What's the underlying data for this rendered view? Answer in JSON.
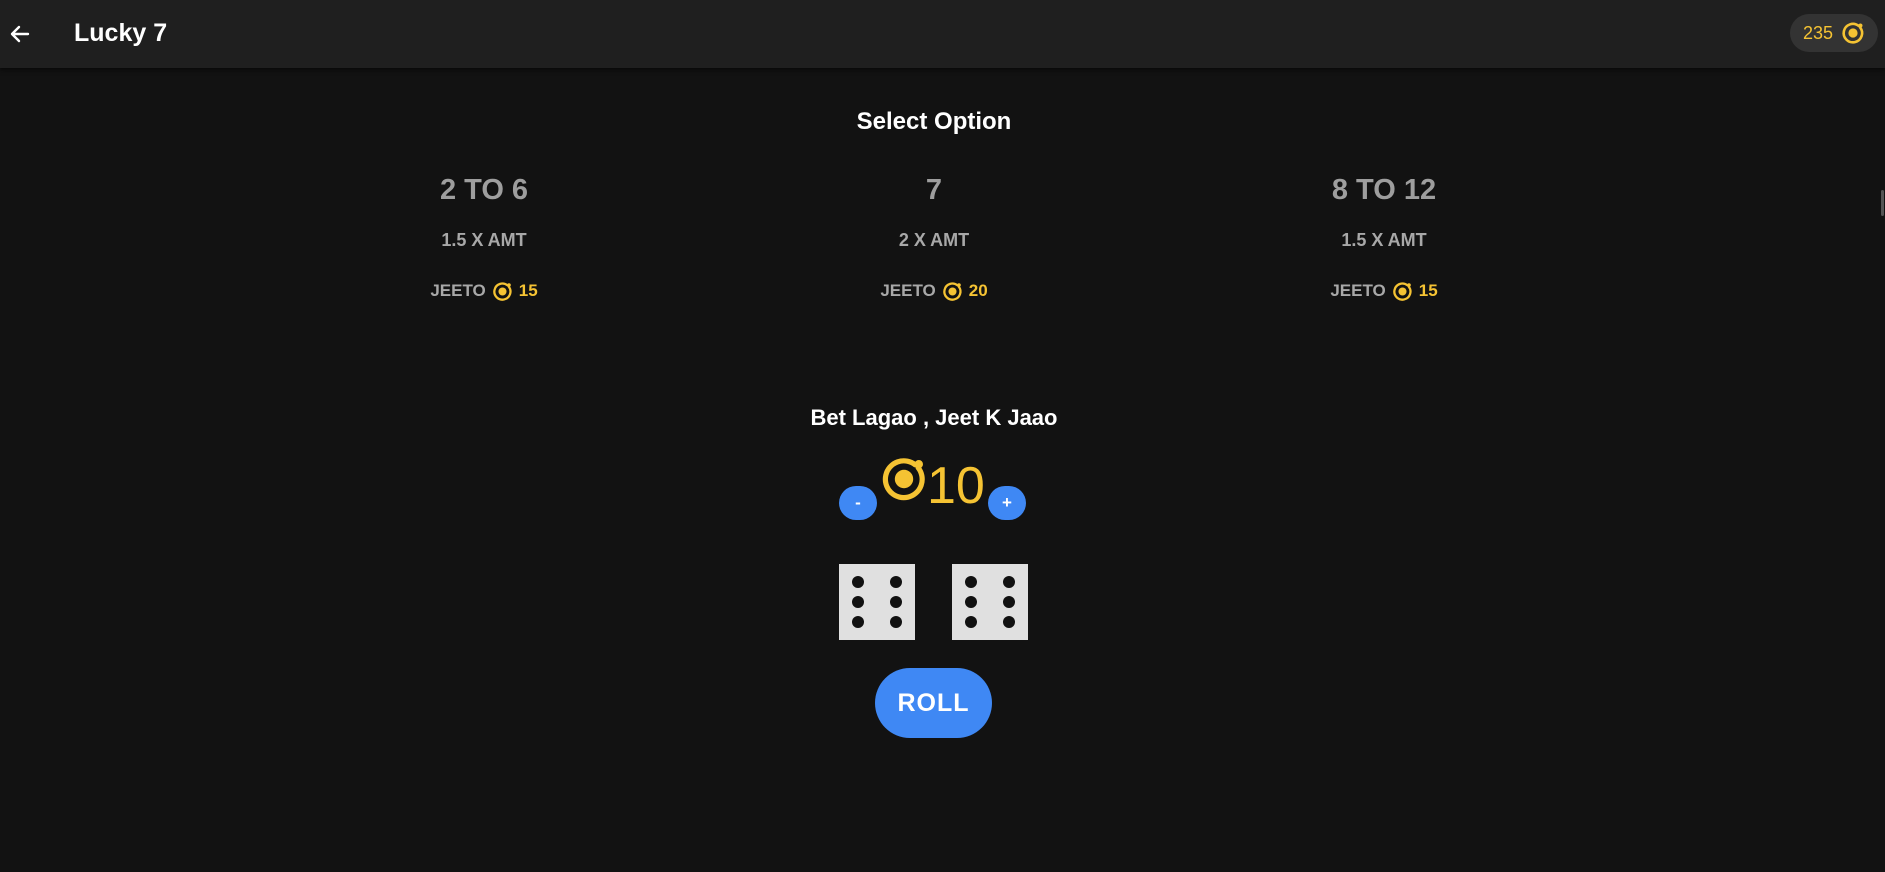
{
  "header": {
    "title": "Lucky 7",
    "balance": "235",
    "back_icon": "arrow-left-icon",
    "coin_icon": "coin-icon"
  },
  "colors": {
    "background": "#121212",
    "topbar": "#1f1f1f",
    "accent_blue": "#3f88f4",
    "coin_gold": "#f5c333",
    "muted_text": "#9e9e9e"
  },
  "select_option": {
    "title": "Select Option",
    "options": [
      {
        "range": "2 TO 6",
        "multiplier": "1.5 X AMT",
        "jeeto_label": "JEETO",
        "jeeto_amount": "15"
      },
      {
        "range": "7",
        "multiplier": "2 X AMT",
        "jeeto_label": "JEETO",
        "jeeto_amount": "20"
      },
      {
        "range": "8 TO 12",
        "multiplier": "1.5 X AMT",
        "jeeto_label": "JEETO",
        "jeeto_amount": "15"
      }
    ]
  },
  "bet": {
    "title": "Bet Lagao , Jeet K Jaao",
    "minus_label": "-",
    "plus_label": "+",
    "amount": "10"
  },
  "dice": {
    "die1_value": 6,
    "die2_value": 6
  },
  "roll": {
    "label": "ROLL"
  }
}
